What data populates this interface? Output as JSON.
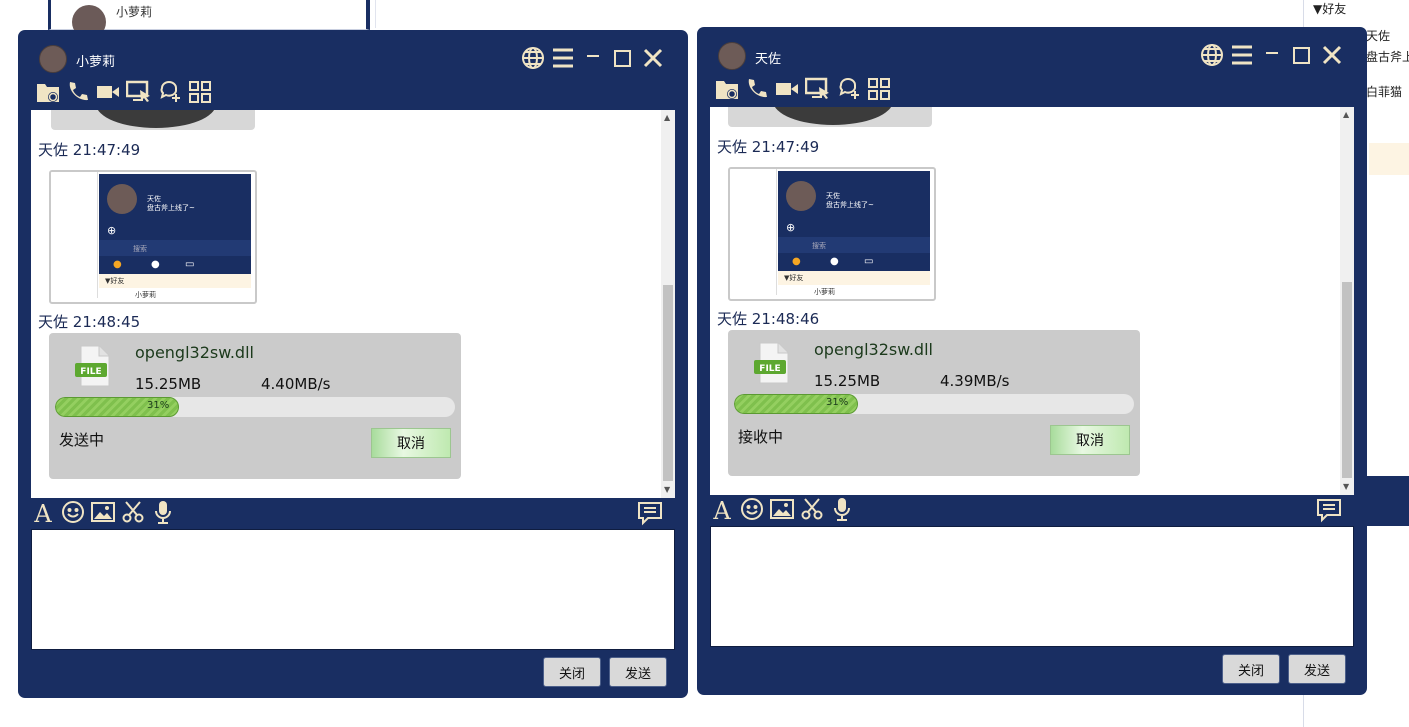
{
  "background": {
    "contact_panel": {
      "name": "小萝莉"
    },
    "right_panel": {
      "group_label": "▼好友",
      "contact_name": "天佐",
      "contact_status": "盘古斧上",
      "other_contact": "白菲猫"
    }
  },
  "windows": [
    {
      "title_name": "小萝莉",
      "messages": [
        {
          "sender": "天佐",
          "time": "21:47:49"
        },
        {
          "sender": "天佐",
          "time": "21:48:45"
        }
      ],
      "thumbnail": {
        "name": "天佐",
        "status": "盘古斧上线了~",
        "search": "搜索",
        "group": "好友",
        "contact": "小萝莉"
      },
      "file": {
        "name": "opengl32sw.dll",
        "size": "15.25MB",
        "speed": "4.40MB/s",
        "progress_label": "31%",
        "progress": 0.31,
        "status": "发送中",
        "cancel": "取消"
      },
      "buttons": {
        "close": "关闭",
        "send": "发送"
      }
    },
    {
      "title_name": "天佐",
      "messages": [
        {
          "sender": "天佐",
          "time": "21:47:49"
        },
        {
          "sender": "天佐",
          "time": "21:48:46"
        }
      ],
      "thumbnail": {
        "name": "天佐",
        "status": "盘古斧上线了~",
        "search": "搜索",
        "group": "好友",
        "contact": "小萝莉"
      },
      "file": {
        "name": "opengl32sw.dll",
        "size": "15.25MB",
        "speed": "4.39MB/s",
        "progress_label": "31%",
        "progress": 0.31,
        "status": "接收中",
        "cancel": "取消"
      },
      "buttons": {
        "close": "关闭",
        "send": "发送"
      }
    }
  ],
  "colors": {
    "window_bg": "#192e62",
    "icon": "#f0e4c4",
    "progress_fill": "#8bc858",
    "cancel_button": "#bfe9b0"
  },
  "icons": [
    "globe-icon",
    "menu-icon",
    "minimize-icon",
    "maximize-icon",
    "close-icon",
    "folder-icon",
    "phone-icon",
    "video-icon",
    "screen-share-icon",
    "chat-add-icon",
    "apps-icon",
    "font-icon",
    "emoji-icon",
    "image-icon",
    "scissors-icon",
    "microphone-icon",
    "message-history-icon",
    "file-icon"
  ]
}
